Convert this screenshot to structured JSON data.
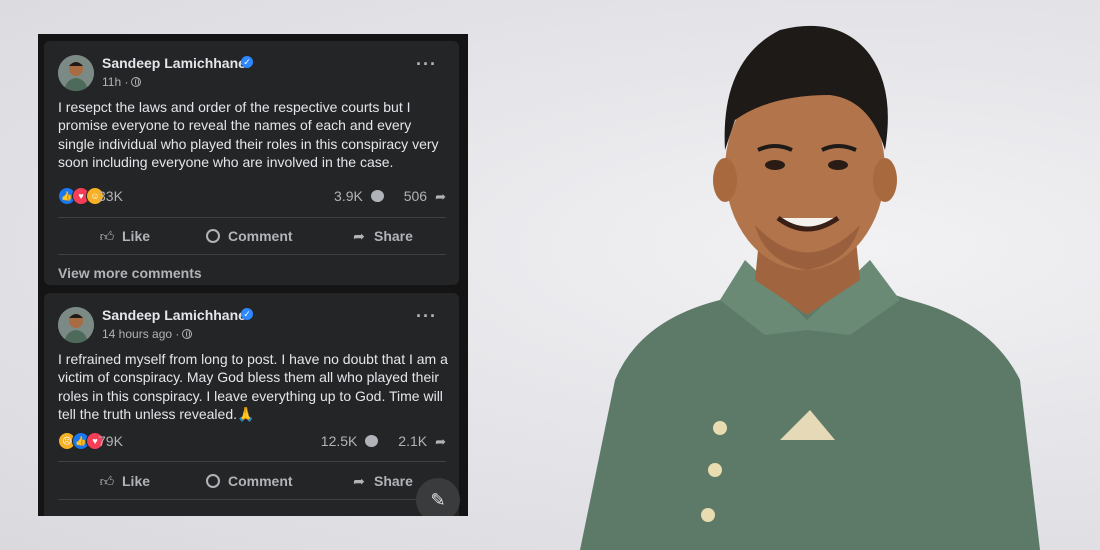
{
  "posts": [
    {
      "author": "Sandeep Lamichhane",
      "time": "11h ·",
      "text": "I resepct the laws and order of the respective courts but I promise everyone to reveal the names of each and every single individual who played their roles in this conspiracy very soon including everyone who are involved in the case.",
      "reaction_count": "33K",
      "comment_count": "3.9K",
      "share_count": "506",
      "footer": "View more comments"
    },
    {
      "author": "Sandeep Lamichhane",
      "time": "14 hours ago ·",
      "text": "I refrained myself from long to post. I have no doubt that I am a victim of conspiracy. May God bless them all who played their roles in this conspiracy. I leave everything up to God. Time will tell the truth unless revealed.🙏",
      "reaction_count": "79K",
      "comment_count": "12.5K",
      "share_count": "2.1K"
    }
  ],
  "actions": {
    "like": "Like",
    "comment": "Comment",
    "share": "Share"
  },
  "icons": [
    "verified-badge-icon",
    "globe-icon",
    "more-options-icon",
    "like-icon",
    "love-icon",
    "care-icon",
    "sad-icon",
    "comment-icon",
    "share-icon",
    "compose-icon"
  ],
  "colors": {
    "panel_bg": "#242526",
    "text": "#e4e6eb",
    "muted": "#b0b3b8",
    "verified": "#2d88ff",
    "jacket": "#5d7a68"
  }
}
